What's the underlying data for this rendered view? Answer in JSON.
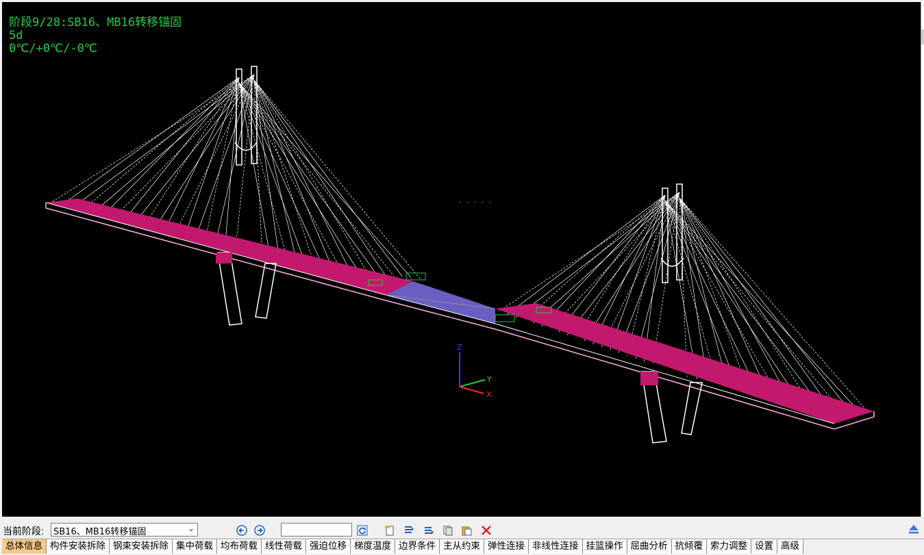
{
  "hud": {
    "stage_line": "阶段9/28:SB16、MB16转移锚固",
    "duration": "5d",
    "temperature": "0℃/+0℃/-0℃"
  },
  "axes": {
    "z": "Z",
    "y": "Y",
    "x": "X"
  },
  "toolbar": {
    "stage_label": "当前阶段:",
    "stage_value": "SB16、MB16转移锚固",
    "nav_input_value": ""
  },
  "tabs": [
    {
      "label": "总体信息",
      "active": true
    },
    {
      "label": "构件安装拆除"
    },
    {
      "label": "钢束安装拆除"
    },
    {
      "label": "集中荷载"
    },
    {
      "label": "均布荷载"
    },
    {
      "label": "线性荷载"
    },
    {
      "label": "强迫位移"
    },
    {
      "label": "梯度温度"
    },
    {
      "label": "边界条件"
    },
    {
      "label": "主从约束"
    },
    {
      "label": "弹性连接"
    },
    {
      "label": "非线性连接"
    },
    {
      "label": "挂篮操作"
    },
    {
      "label": "屈曲分析"
    },
    {
      "label": "抗倾覆"
    },
    {
      "label": "索力调整"
    },
    {
      "label": "设置"
    },
    {
      "label": "高级"
    }
  ],
  "colors": {
    "deck": "#c2196e",
    "closure": "#6a5fc0",
    "cable": "#ffffff",
    "hud_text": "#22cc44",
    "active_tab": "#f7c98a"
  }
}
